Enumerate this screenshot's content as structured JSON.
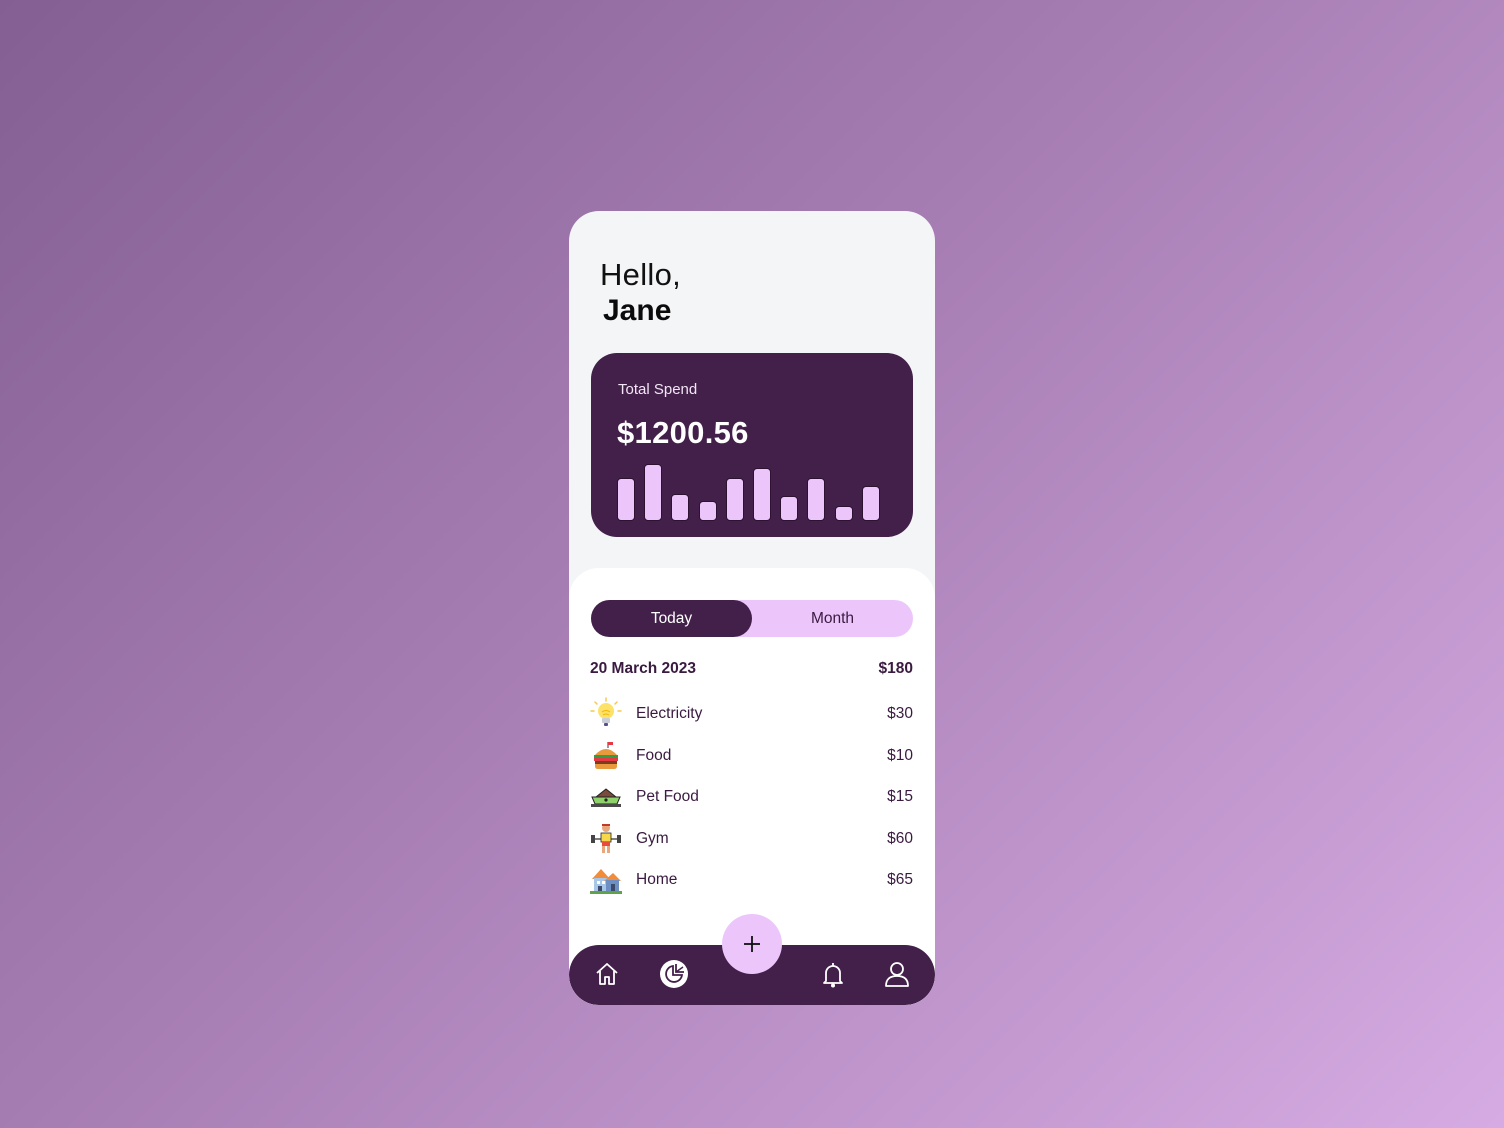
{
  "greeting": {
    "hello": "Hello,",
    "name": "Jane"
  },
  "summary_card": {
    "label": "Total Spend",
    "amount": "$1200.56",
    "chart_data": {
      "type": "bar",
      "title": "",
      "categories": [
        "1",
        "2",
        "3",
        "4",
        "5",
        "6",
        "7",
        "8",
        "9",
        "10"
      ],
      "values": [
        43,
        57,
        27,
        20,
        43,
        53,
        25,
        43,
        15,
        35
      ],
      "ylim": [
        0,
        60
      ],
      "grid": false,
      "axes": false
    }
  },
  "tabs": [
    {
      "label": "Today",
      "active": true
    },
    {
      "label": "Month",
      "active": false
    }
  ],
  "day": {
    "date": "20 March 2023",
    "total": "$180"
  },
  "transactions": [
    {
      "icon": "lightbulb-icon",
      "name": "Electricity",
      "amount": "$30"
    },
    {
      "icon": "burger-icon",
      "name": "Food",
      "amount": "$10"
    },
    {
      "icon": "pet-bowl-icon",
      "name": "Pet Food",
      "amount": "$15"
    },
    {
      "icon": "weightlifter-icon",
      "name": "Gym",
      "amount": "$60"
    },
    {
      "icon": "house-icon",
      "name": "Home",
      "amount": "$65"
    }
  ],
  "nav": {
    "items": [
      "home-icon",
      "pie-chart-icon",
      "add-icon",
      "bell-icon",
      "user-icon"
    ],
    "fab_label": "+"
  },
  "colors": {
    "primary": "#43204a",
    "accent": "#ecc6fb",
    "bg_card": "#f4f5f7"
  }
}
